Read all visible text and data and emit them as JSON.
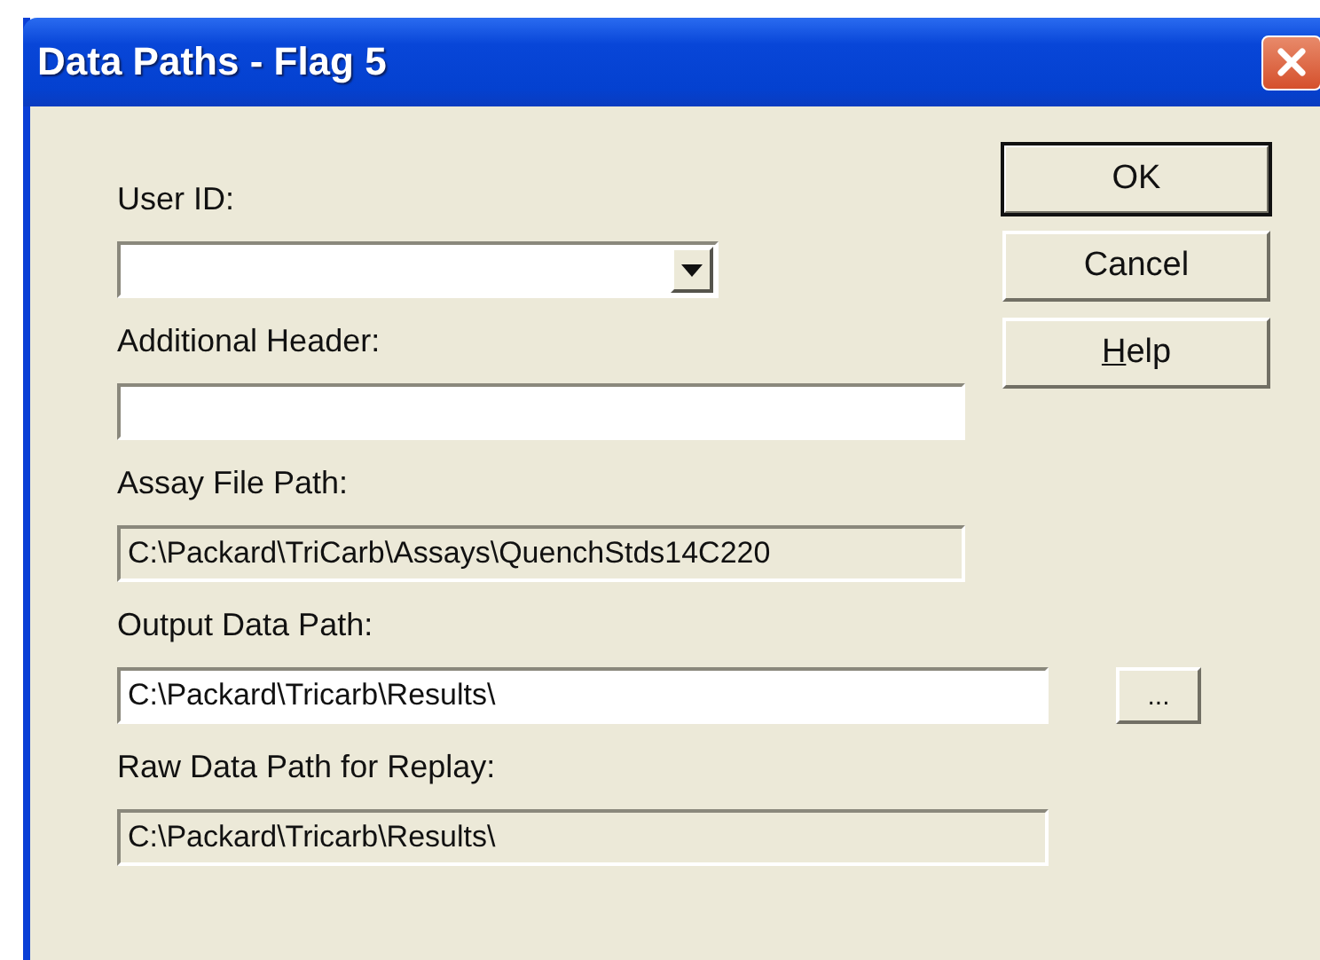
{
  "window": {
    "title": "Data Paths - Flag 5"
  },
  "fields": [
    {
      "kind": "combo",
      "label": "User ID:",
      "disabled": false
    },
    {
      "kind": "text",
      "label": "Additional Header:",
      "disabled": false
    },
    {
      "kind": "text",
      "label": "Assay File Path:",
      "value": "C:\\Packard\\TriCarb\\Assays\\QuenchStds14C220",
      "disabled": true
    },
    {
      "kind": "browse",
      "label": "Output Data Path:",
      "value": "C:\\Packard\\Tricarb\\Results\\",
      "disabled": false,
      "button": "..."
    },
    {
      "kind": "wide",
      "label": "Raw Data Path for Replay:",
      "value": "C:\\Packard\\Tricarb\\Results\\",
      "disabled": true
    }
  ],
  "buttons": [
    {
      "label": "OK",
      "default": true,
      "underline_first": false
    },
    {
      "label": "Cancel",
      "default": false,
      "underline_first": false
    },
    {
      "label": "Help",
      "default": false,
      "underline_first": true
    }
  ]
}
